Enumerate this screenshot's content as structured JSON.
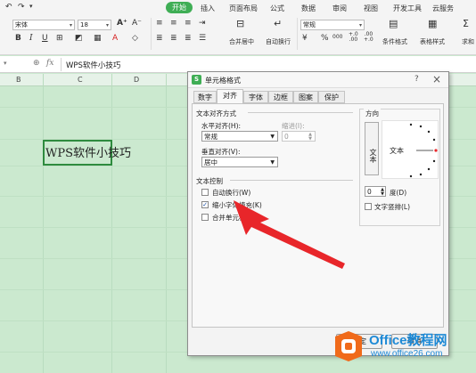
{
  "ribbon": {
    "tabs": [
      "开始",
      "插入",
      "页面布局",
      "公式",
      "数据",
      "审阅",
      "视图",
      "开发工具",
      "云服务"
    ],
    "font_name": "宋体",
    "font_size": "18",
    "number_format": "常规",
    "merge_label": "合并居中",
    "wrap_label": "自动换行",
    "condfmt_label": "条件格式",
    "tablefmt_label": "表格样式",
    "sum_label": "求和",
    "percent": "%",
    "thousands": "000",
    "inc_decimal": "+.0\n.00",
    "dec_decimal": ".00\n+.0"
  },
  "formula_bar": {
    "fx": "fx",
    "content": "WPS软件小技巧"
  },
  "columns": [
    "B",
    "C",
    "D"
  ],
  "cell": {
    "text": "WPS软件小技巧"
  },
  "dialog": {
    "title": "单元格格式",
    "tabs": [
      "数字",
      "对齐",
      "字体",
      "边框",
      "图案",
      "保护"
    ],
    "text_align_section": "文本对齐方式",
    "horizontal_label": "水平对齐(H):",
    "horizontal_value": "常规",
    "indent_label": "缩进(I):",
    "indent_value": "0",
    "vertical_label": "垂直对齐(V):",
    "vertical_value": "居中",
    "text_control_section": "文本控制",
    "checkboxes": [
      {
        "label": "自动换行(W)",
        "checked": false
      },
      {
        "label": "缩小字体填充(K)",
        "checked": true
      },
      {
        "label": "合并单元格",
        "checked": false
      }
    ],
    "orientation_section": "方向",
    "vertical_text": "文本",
    "orientation_text": "文本",
    "degree_value": "0",
    "degree_label": "度(D)",
    "stacked_label": "文字竖排(L)",
    "ok_label": "确定",
    "cancel_label": "取消",
    "help_icon": "?",
    "close_icon": "×"
  },
  "watermark": {
    "brand": "Office教程网",
    "url": "www.office26.com"
  },
  "colors": {
    "accent_green": "#3fae55",
    "sheet_bg": "#cbe9cf",
    "arrow_red": "#e8262a",
    "brand_blue": "#1e8ad6",
    "brand_orange": "#f06a1a"
  }
}
